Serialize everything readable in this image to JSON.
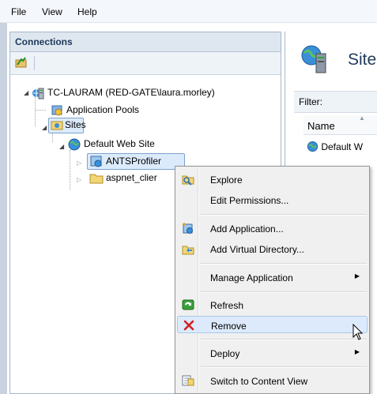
{
  "menubar": {
    "file": "File",
    "view": "View",
    "help": "Help"
  },
  "connections": {
    "title": "Connections",
    "tree": {
      "server": "TC-LAURAM (RED-GATE\\laura.morley)",
      "app_pools": "Application Pools",
      "sites": "Sites",
      "default_site": "Default Web Site",
      "ants": "ANTSProfiler",
      "aspnet": "aspnet_clier"
    }
  },
  "right": {
    "title": "Site",
    "filter": "Filter:",
    "name_col": "Name",
    "row1": "Default W"
  },
  "context_menu": {
    "explore": "Explore",
    "edit_permissions": "Edit Permissions...",
    "add_application": "Add Application...",
    "add_virtual_directory": "Add Virtual Directory...",
    "manage_application": "Manage Application",
    "refresh": "Refresh",
    "remove": "Remove",
    "deploy": "Deploy",
    "switch_content_view": "Switch to Content View"
  },
  "colors": {
    "accent": "#1e395b",
    "selection": "#dcebfc",
    "remove_red": "#d42020"
  },
  "icons": {
    "server": "server-icon",
    "app_pools": "app-pool-icon",
    "sites": "sites-folder-icon",
    "globe": "globe-icon",
    "folder": "folder-icon",
    "explore": "explore-icon",
    "add_app": "add-application-icon",
    "add_vdir": "add-virtual-directory-icon",
    "refresh": "refresh-icon",
    "remove": "remove-x-icon",
    "switch": "content-view-icon"
  }
}
